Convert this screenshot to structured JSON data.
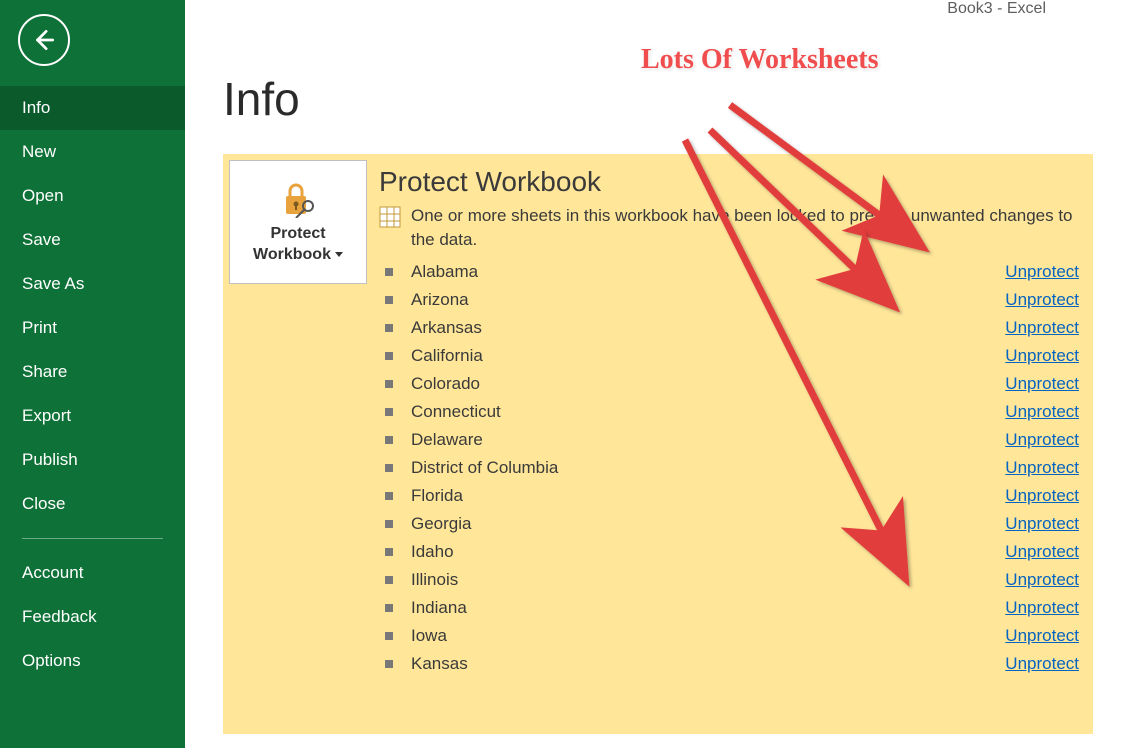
{
  "window_title": "Book3  -  Excel",
  "sidebar": {
    "items": [
      {
        "label": "Info",
        "active": true
      },
      {
        "label": "New"
      },
      {
        "label": "Open"
      },
      {
        "label": "Save"
      },
      {
        "label": "Save As"
      },
      {
        "label": "Print"
      },
      {
        "label": "Share"
      },
      {
        "label": "Export"
      },
      {
        "label": "Publish"
      },
      {
        "label": "Close"
      }
    ],
    "footer_items": [
      {
        "label": "Account"
      },
      {
        "label": "Feedback"
      },
      {
        "label": "Options"
      }
    ]
  },
  "page": {
    "title": "Info",
    "panel": {
      "button_line1": "Protect",
      "button_line2": "Workbook",
      "heading": "Protect Workbook",
      "description": "One or more sheets in this workbook have been locked to prevent unwanted changes to the data.",
      "unprotect_label": "Unprotect",
      "sheets": [
        "Alabama",
        "Arizona",
        "Arkansas",
        "California",
        "Colorado",
        "Connecticut",
        "Delaware",
        "District of Columbia",
        "Florida",
        "Georgia",
        "Idaho",
        "Illinois",
        "Indiana",
        "Iowa",
        "Kansas"
      ]
    }
  },
  "annotation": {
    "text": "Lots Of Worksheets"
  },
  "colors": {
    "sidebar_bg": "#0e7137",
    "sidebar_active": "#0a5a2c",
    "panel_bg": "#ffe699",
    "link": "#0563c1",
    "annotation": "#f04e4e"
  }
}
